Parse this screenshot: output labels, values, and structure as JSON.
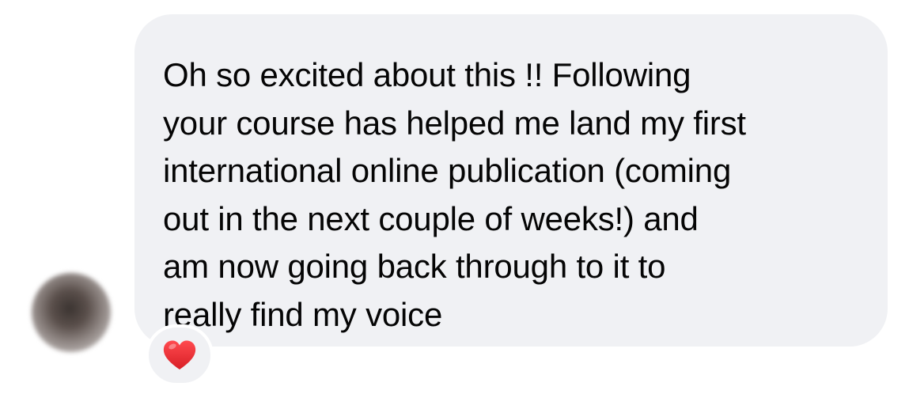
{
  "message": {
    "lines": [
      "Oh so excited about this !! Following",
      "your course has helped me land my first",
      "international online publication (coming",
      "out in the next couple of weeks!) and",
      "am now going back through to it to",
      "really find my voice"
    ]
  },
  "avatar": {
    "icon": "blurred-profile-photo"
  },
  "reaction": {
    "icon": "red-heart-icon",
    "color": "#e8262b"
  },
  "colors": {
    "bubble_background": "#f0f1f4",
    "text": "#050505"
  }
}
